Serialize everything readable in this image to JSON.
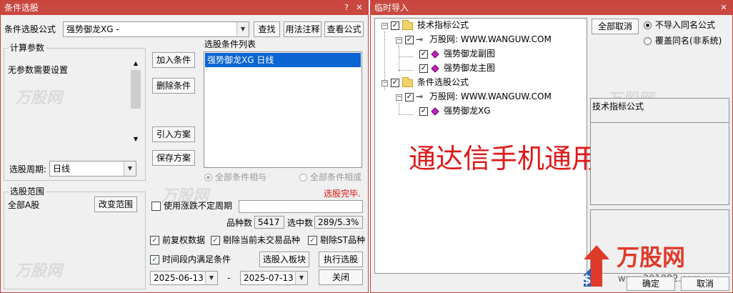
{
  "left_window": {
    "title": "条件选股",
    "formula_label": "条件选股公式",
    "formula_value": "强势御龙XG  -",
    "buttons": {
      "search": "查找",
      "usage": "用法注释",
      "view_formula": "查看公式",
      "add_condition": "加入条件",
      "delete_condition": "删除条件",
      "import_plan": "引入方案",
      "save_plan": "保存方案",
      "change_range": "改变范围",
      "select_to_block": "选股入板块",
      "execute": "执行选股",
      "close": "关闭"
    },
    "params_group_label": "计算参数",
    "no_params_text": "无参数需要设置",
    "period_label": "选股周期:",
    "period_value": "日线",
    "condition_list_label": "选股条件列表",
    "condition_list_items": [
      "强势御龙XG  日线"
    ],
    "radio_and": "全部条件相与",
    "radio_or": "全部条件相或",
    "status_text": "选股完毕.",
    "range_group_label": "选股范围",
    "range_value": "全部A股",
    "use_irregular_period": "使用涨跌不定周期",
    "count_label": "品种数",
    "count_value": "5417",
    "selected_label": "选中数",
    "selected_value": "289/5.3%",
    "chk_pre_adjust": "前复权数据",
    "chk_remove_untraded": "剔除当前未交易品种",
    "chk_remove_st": "剔除ST品种",
    "chk_time_range": "时间段内满足条件",
    "date_from": "2025-06-13",
    "date_sep": "-",
    "date_to": "2025-07-13",
    "watermark": "万股网"
  },
  "right_window": {
    "title": "临时导入",
    "tree": [
      {
        "label": "技术指标公式",
        "type": "folder"
      },
      {
        "label": "万股网: WWW.WANGUW.COM",
        "type": "author"
      },
      {
        "label": "强势御龙副图",
        "type": "formula"
      },
      {
        "label": "强势御龙主图",
        "type": "formula"
      },
      {
        "label": "条件选股公式",
        "type": "folder"
      },
      {
        "label": "万股网: WWW.WANGUW.COM",
        "type": "author"
      },
      {
        "label": "强势御龙XG",
        "type": "formula"
      }
    ],
    "cancel_all_button": "全部取消",
    "radio_no_import": "不导入同名公式",
    "radio_overwrite": "覆盖同名(非系统)",
    "info_text": "技术指标公式",
    "overlay_text": "通达信手机通用",
    "ok_button": "确定",
    "cancel_button": "取消",
    "logo_text": "万股网",
    "logo_url": "www.201082.com",
    "watermark": "万股网"
  },
  "colors": {
    "title_bar": "#c9483f",
    "selection": "#0a64d2",
    "status_red": "#e01010",
    "overlay_red": "#e01818"
  }
}
